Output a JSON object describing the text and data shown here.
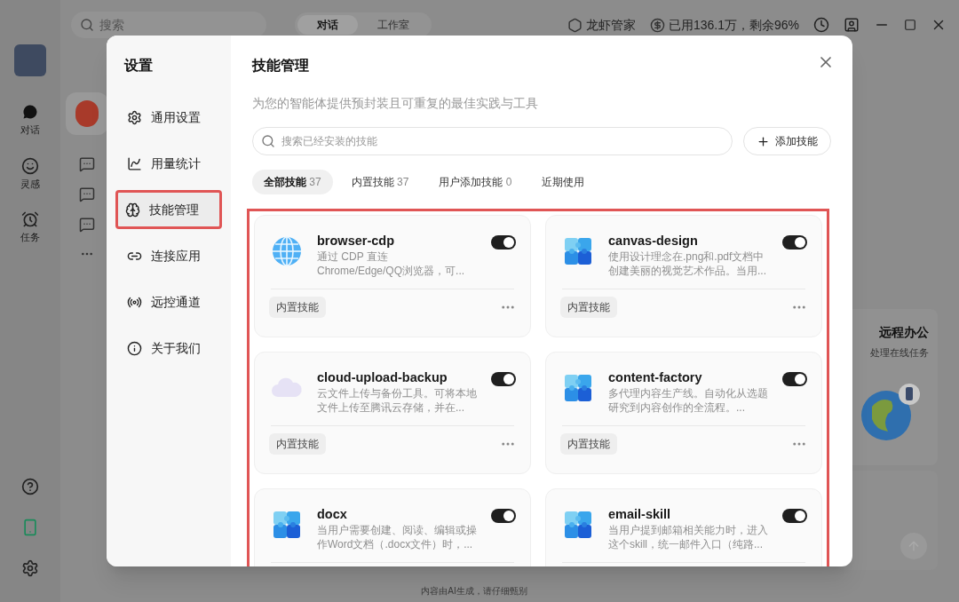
{
  "app": {
    "search": {
      "placeholder": "搜索"
    },
    "mode_tabs": [
      {
        "label": "对话",
        "selected": true
      },
      {
        "label": "工作室",
        "selected": false
      }
    ],
    "assistant": "龙虾管家",
    "usage": "已用136.1万，剩余96%",
    "rail": [
      {
        "label": "对话",
        "selected": true
      },
      {
        "label": "灵感",
        "selected": false
      },
      {
        "label": "任务",
        "selected": false
      }
    ],
    "banner": {
      "title": "远程办公",
      "subtitle": "处理在线任务"
    },
    "footer_note": "内容由AI生成，请仔细甄别"
  },
  "dialog": {
    "nav_title": "设置",
    "nav": [
      {
        "label": "通用设置",
        "selected": false
      },
      {
        "label": "用量统计",
        "selected": false
      },
      {
        "label": "技能管理",
        "selected": true
      },
      {
        "label": "连接应用",
        "selected": false
      },
      {
        "label": "远控通道",
        "selected": false
      },
      {
        "label": "关于我们",
        "selected": false
      }
    ],
    "title": "技能管理",
    "subtitle": "为您的智能体提供预封装且可重复的最佳实践与工具",
    "search": {
      "placeholder": "搜索已经安装的技能"
    },
    "add_button": "添加技能",
    "filters": [
      {
        "label": "全部技能",
        "count": "37",
        "selected": true
      },
      {
        "label": "内置技能",
        "count": "37",
        "selected": false
      },
      {
        "label": "用户添加技能",
        "count": "0",
        "selected": false
      },
      {
        "label": "近期使用",
        "selected": false
      }
    ],
    "skills": [
      {
        "name": "browser-cdp",
        "description_lines": [
          "通过 CDP 直连",
          "Chrome/Edge/QQ浏览器，可..."
        ],
        "enabled": true,
        "tag": "内置技能"
      },
      {
        "name": "canvas-design",
        "description_lines": [
          "使用设计理念在.png和.pdf文档中",
          "创建美丽的视觉艺术作品。当用..."
        ],
        "enabled": true,
        "tag": "内置技能"
      },
      {
        "name": "cloud-upload-backup",
        "description_lines": [
          "云文件上传与备份工具。可将本地",
          "文件上传至腾讯云存储，并在..."
        ],
        "enabled": true,
        "tag": "内置技能"
      },
      {
        "name": "content-factory",
        "description_lines": [
          "多代理内容生产线。自动化从选题",
          "研究到内容创作的全流程。..."
        ],
        "enabled": true,
        "tag": "内置技能"
      },
      {
        "name": "docx",
        "description_lines": [
          "当用户需要创建、阅读、编辑或操",
          "作Word文档（.docx文件）时，..."
        ],
        "enabled": true
      },
      {
        "name": "email-skill",
        "description_lines": [
          "当用户提到邮箱相关能力时，进入",
          "这个skill，统一邮件入口（纯路..."
        ],
        "enabled": true
      }
    ]
  }
}
